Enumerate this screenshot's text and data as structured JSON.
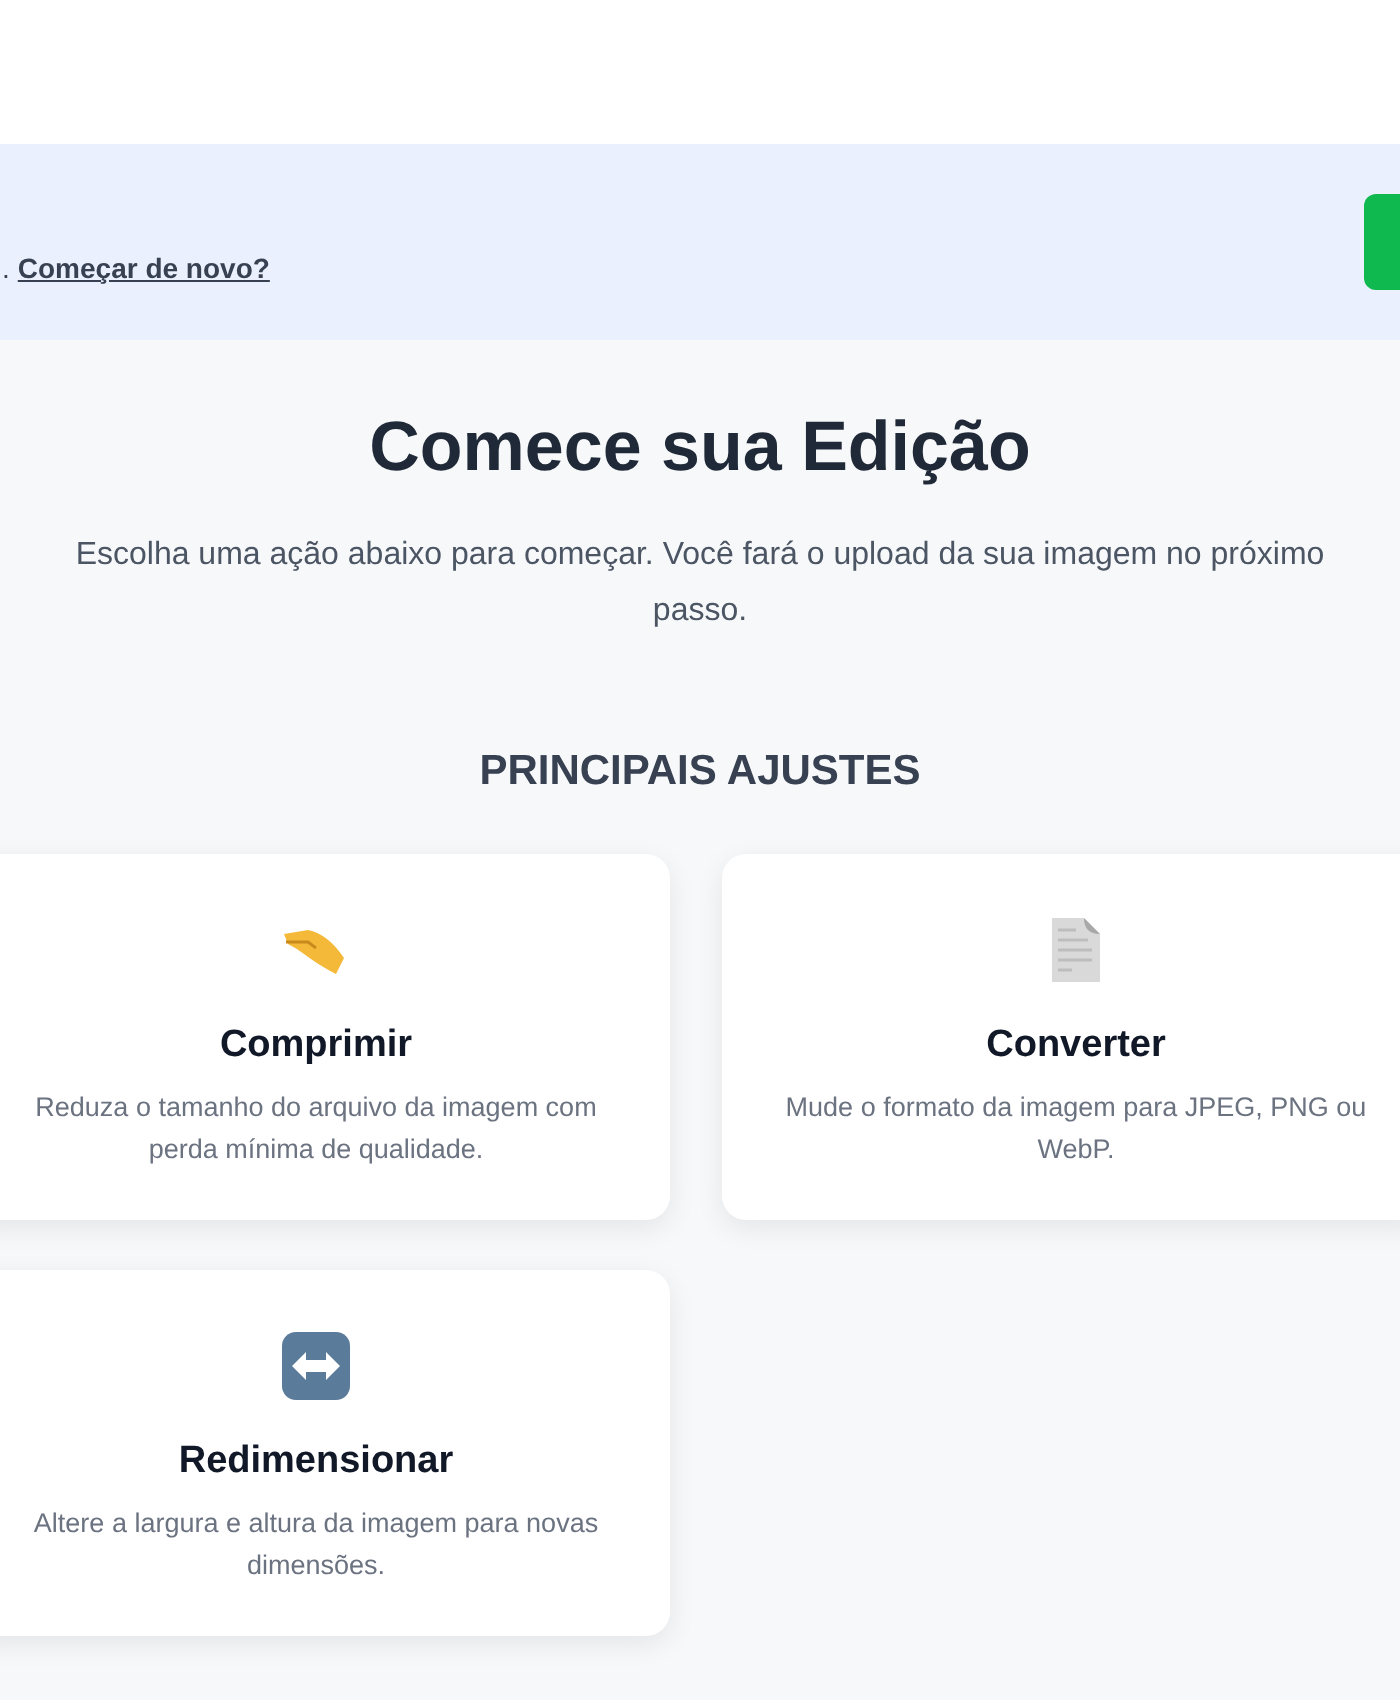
{
  "banner": {
    "text_fragment": ".",
    "link": "Começar de novo?"
  },
  "heading": "Comece sua Edição",
  "subtitle": "Escolha uma ação abaixo para começar. Você fará o upload da sua imagem no próximo passo.",
  "section": {
    "title": "PRINCIPAIS AJUSTES",
    "cards": [
      {
        "kind": "compress",
        "title": "Comprimir",
        "description": "Reduza o tamanho do arquivo da imagem com perda mínima de qualidade."
      },
      {
        "kind": "convert",
        "title": "Converter",
        "description": "Mude o formato da imagem para JPEG, PNG ou WebP."
      },
      {
        "kind": "resize",
        "title": "Redimensionar",
        "description": "Altere a largura e altura da imagem para novas dimensões."
      }
    ]
  }
}
